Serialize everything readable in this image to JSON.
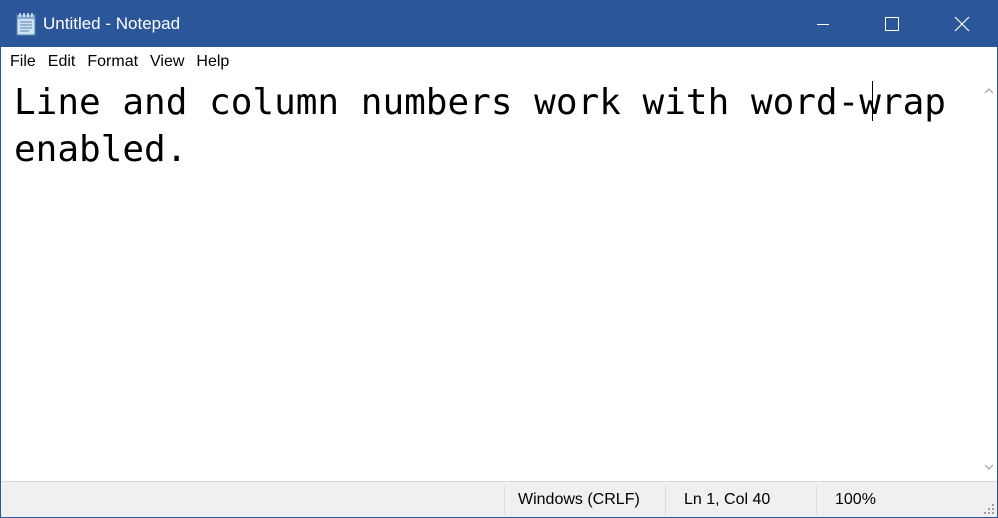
{
  "window": {
    "title": "Untitled - Notepad",
    "icons": {
      "app": "notepad-icon",
      "minimize": "minimize-icon",
      "maximize": "maximize-icon",
      "close": "close-icon"
    }
  },
  "menu": {
    "items": [
      {
        "label": "File"
      },
      {
        "label": "Edit"
      },
      {
        "label": "Format"
      },
      {
        "label": "View"
      },
      {
        "label": "Help"
      }
    ]
  },
  "editor": {
    "text": "Line and column numbers work with word-wrap\nenabled.",
    "word_wrap": true
  },
  "statusbar": {
    "line_ending": "Windows (CRLF)",
    "position": "Ln 1, Col 40",
    "zoom": "100%"
  },
  "colors": {
    "titlebar": "#2b579a",
    "statusbar": "#f0f0f0"
  }
}
